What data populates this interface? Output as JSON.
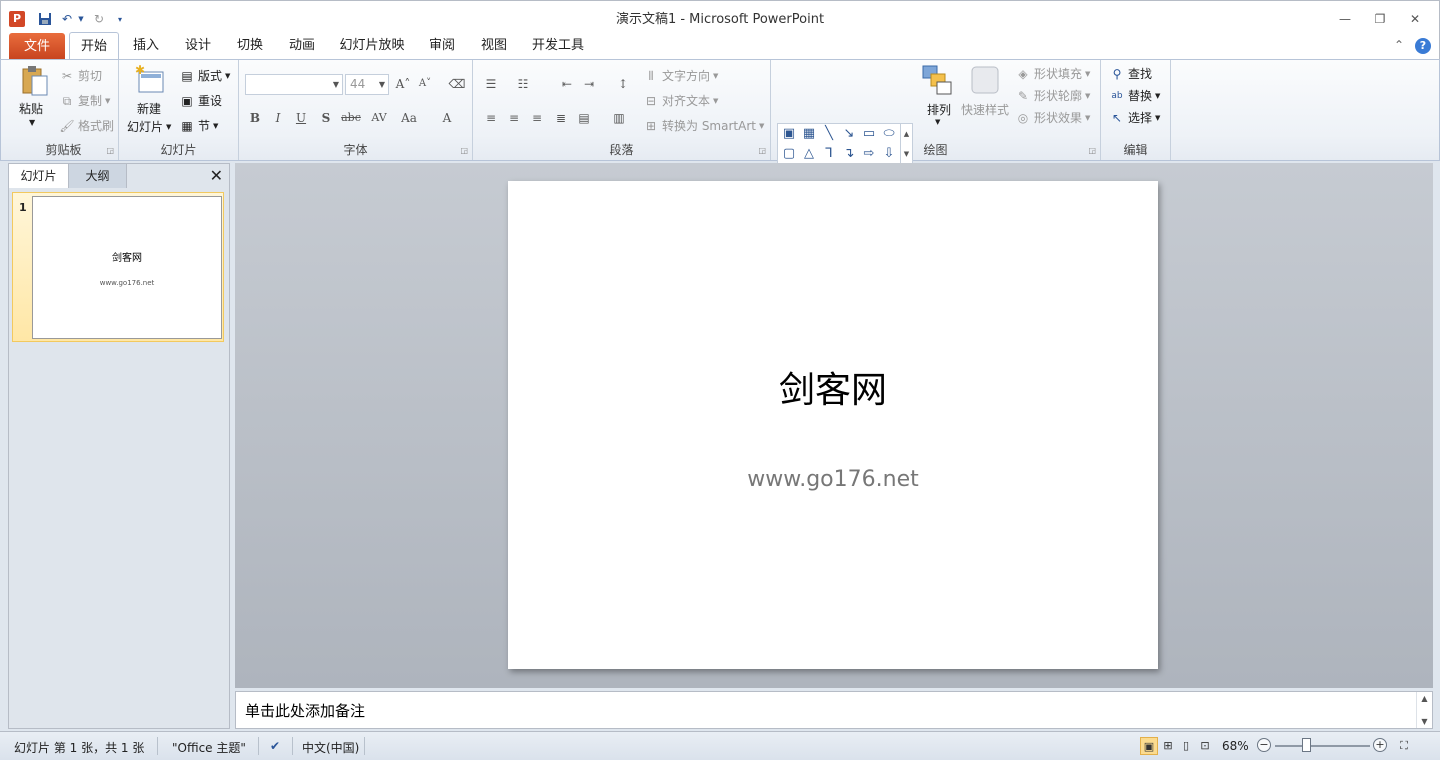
{
  "window": {
    "title": "演示文稿1  -  Microsoft PowerPoint",
    "app_icon": "P"
  },
  "tabs": {
    "file": "文件",
    "home": "开始",
    "insert": "插入",
    "design": "设计",
    "transitions": "切换",
    "animations": "动画",
    "slideshow": "幻灯片放映",
    "review": "审阅",
    "view": "视图",
    "developer": "开发工具"
  },
  "ribbon": {
    "clipboard": {
      "label": "剪贴板",
      "paste": "粘贴",
      "cut": "剪切",
      "copy": "复制",
      "format_painter": "格式刷"
    },
    "slides": {
      "label": "幻灯片",
      "new_slide_line1": "新建",
      "new_slide_line2": "幻灯片",
      "layout": "版式",
      "reset": "重设",
      "section": "节"
    },
    "font": {
      "label": "字体",
      "font_name": "",
      "font_size": "44",
      "bold": "B",
      "italic": "I",
      "underline": "U",
      "shadow": "S",
      "strike": "abc",
      "spacing": "AV",
      "case": "Aa",
      "grow": "A",
      "shrink": "A",
      "color": "A"
    },
    "paragraph": {
      "label": "段落",
      "text_direction": "文字方向",
      "align_text": "对齐文本",
      "smartart": "转换为 SmartArt"
    },
    "drawing": {
      "label": "绘图",
      "arrange": "排列",
      "quick_styles": "快速样式",
      "shape_fill": "形状填充",
      "shape_outline": "形状轮廓",
      "shape_effects": "形状效果"
    },
    "editing": {
      "label": "编辑",
      "find": "查找",
      "replace": "替换",
      "select": "选择"
    }
  },
  "slides_panel": {
    "tab_slides": "幻灯片",
    "tab_outline": "大纲",
    "thumb": {
      "number": "1",
      "title": "剑客网",
      "subtitle": "www.go176.net"
    }
  },
  "slide": {
    "title": "剑客网",
    "subtitle": "www.go176.net"
  },
  "notes": {
    "placeholder": "单击此处添加备注"
  },
  "status": {
    "slide_info": "幻灯片 第 1 张，共 1 张",
    "theme": "\"Office 主题\"",
    "language": "中文(中国)",
    "zoom": "68%"
  }
}
